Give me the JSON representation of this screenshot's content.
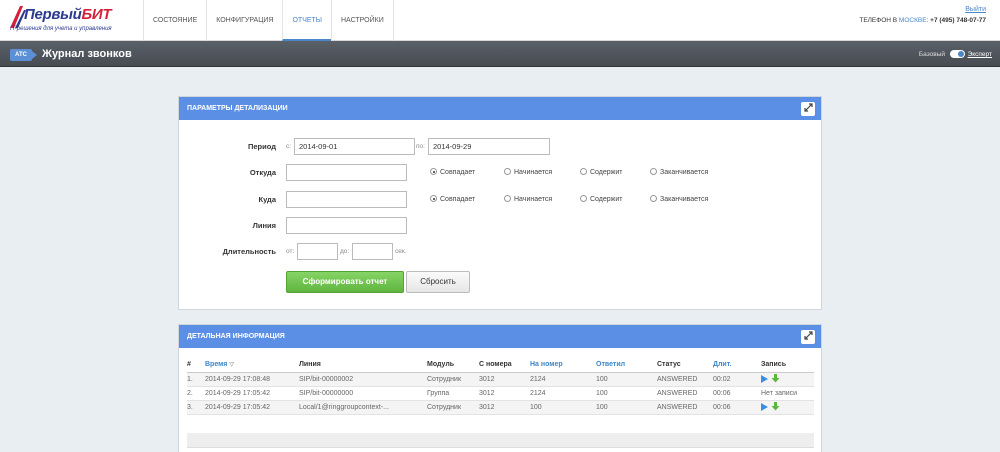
{
  "header": {
    "logo_main": "Первый",
    "logo_accent": "БИТ",
    "logo_sub": "IT-решения для учета и управления",
    "nav": [
      {
        "label": "Состояние",
        "active": false
      },
      {
        "label": "Конфигурация",
        "active": false
      },
      {
        "label": "Отчеты",
        "active": true
      },
      {
        "label": "Настройки",
        "active": false
      }
    ],
    "logout": "Выйти",
    "phone_prefix": "Телефон в",
    "phone_city": "Москве",
    "phone_number": "+7 (495) 748-07-77"
  },
  "titlebar": {
    "badge": "АТС",
    "title": "Журнал звонков",
    "mode_basic": "Базовый",
    "mode_expert": "Эксперт"
  },
  "params": {
    "title": "Параметры детализации",
    "period_label": "Период",
    "from_prefix": "с:",
    "from_value": "2014-09-01",
    "to_prefix": "по:",
    "to_value": "2014-09-29",
    "from_label": "Откуда",
    "to_label": "Куда",
    "line_label": "Линия",
    "duration_label": "Длительность",
    "dur_from_prefix": "от:",
    "dur_to_prefix": "до:",
    "dur_unit": "сек.",
    "match_options": [
      "Совпадает",
      "Начинается",
      "Содержит",
      "Заканчивается"
    ],
    "submit": "Сформировать отчет",
    "reset": "Сбросить"
  },
  "details": {
    "title": "Детальная информация",
    "columns": [
      "#",
      "Время",
      "Линия",
      "Модуль",
      "С номера",
      "На номер",
      "Ответил",
      "Статус",
      "Длит.",
      "Запись"
    ],
    "rows": [
      {
        "n": "1.",
        "time": "2014-09-29 17:08:48",
        "line": "SIP/bit-00000002",
        "module": "Сотрудник",
        "from": "3012",
        "to": "2124",
        "answered": "100",
        "status": "ANSWERED",
        "dur": "00:02",
        "record": ""
      },
      {
        "n": "2.",
        "time": "2014-09-29 17:05:42",
        "line": "SIP/bit-00000000",
        "module": "Группа",
        "from": "3012",
        "to": "2124",
        "answered": "100",
        "status": "ANSWERED",
        "dur": "00:06",
        "record": "Нет записи"
      },
      {
        "n": "3.",
        "time": "2014-09-29 17:05:42",
        "line": "Local/1@ringgroupcontext-...",
        "module": "Сотрудник",
        "from": "3012",
        "to": "100",
        "answered": "100",
        "status": "ANSWERED",
        "dur": "00:06",
        "record": ""
      }
    ]
  }
}
